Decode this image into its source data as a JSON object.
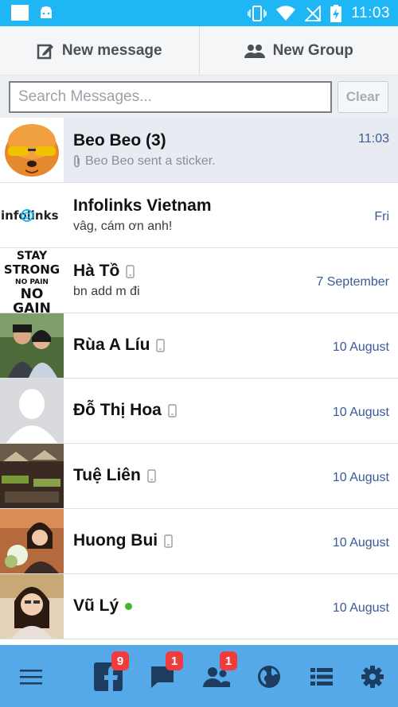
{
  "status_bar": {
    "time": "11:03"
  },
  "action_bar": {
    "new_message_label": "New message",
    "new_group_label": "New Group"
  },
  "search": {
    "placeholder": "Search Messages...",
    "value": "",
    "clear_label": "Clear"
  },
  "conversations": [
    {
      "name": "Beo Beo (3)",
      "preview": "Beo Beo sent a sticker.",
      "date": "11:03",
      "unread": true,
      "attachment_icon": "paperclip-icon"
    },
    {
      "name": "Infolinks Vietnam",
      "preview": "vâg, cám ơn anh!",
      "date": "Fri",
      "avatar_text": "infolinks"
    },
    {
      "name": "Hà Tồ",
      "preview": "bn add m đi",
      "date": "7 September",
      "device_icon": "mobile-phone-icon",
      "avatar_lines": [
        "STAY",
        "STRONG",
        "NO PAIN",
        "NO",
        "GAIN"
      ]
    },
    {
      "name": "Rùa A Líu",
      "date": "10 August",
      "device_icon": "mobile-phone-icon"
    },
    {
      "name": "Đỗ Thị Hoa",
      "date": "10 August",
      "device_icon": "mobile-phone-icon"
    },
    {
      "name": "Tuệ Liên",
      "date": "10 August",
      "device_icon": "mobile-phone-icon"
    },
    {
      "name": "Huong Bui",
      "date": "10 August",
      "device_icon": "mobile-phone-icon"
    },
    {
      "name": "Vũ Lý",
      "date": "10 August",
      "online": true
    }
  ],
  "bottom_nav": {
    "items": [
      {
        "icon": "menu-icon"
      },
      {
        "icon": "facebook-icon",
        "badge": "9"
      },
      {
        "icon": "messages-icon",
        "badge": "1"
      },
      {
        "icon": "friend-requests-icon",
        "badge": "1"
      },
      {
        "icon": "globe-icon"
      },
      {
        "icon": "list-icon"
      },
      {
        "icon": "gear-icon"
      }
    ]
  },
  "colors": {
    "status_bar": "#1eb6f5",
    "bottom_nav": "#56a9e8",
    "date_text": "#3b5998",
    "badge": "#f03c3c",
    "online_dot": "#42b72a"
  }
}
